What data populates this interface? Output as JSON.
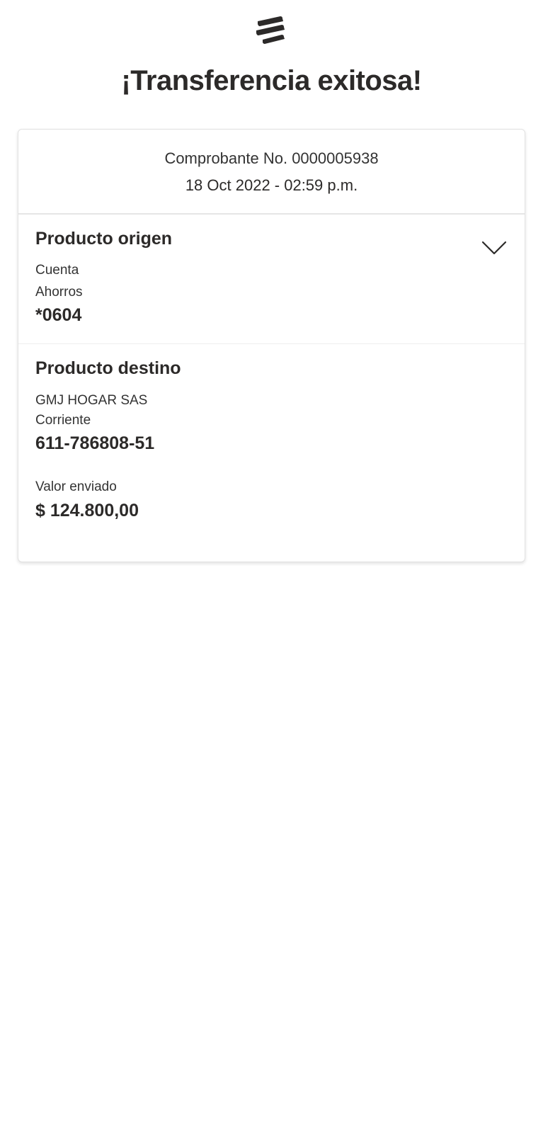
{
  "header": {
    "logo_icon": "bancolombia-logo-icon",
    "title": "¡Transferencia exitosa!"
  },
  "receipt": {
    "number": "Comprobante No. 0000005938",
    "date": "18 Oct 2022 - 02:59 p.m."
  },
  "origin": {
    "title": "Producto origen",
    "type": "Cuenta",
    "subtype": "Ahorros",
    "account": "*0604",
    "toggle_icon": "chevron-down-icon"
  },
  "destination": {
    "title": "Producto destino",
    "name": "GMJ HOGAR SAS",
    "type": "Corriente",
    "account": "611-786808-51",
    "amount_label": "Valor enviado",
    "amount": "$ 124.800,00"
  },
  "colors": {
    "text": "#2c2a29",
    "divider": "#e6e6e6",
    "background": "#ffffff"
  }
}
